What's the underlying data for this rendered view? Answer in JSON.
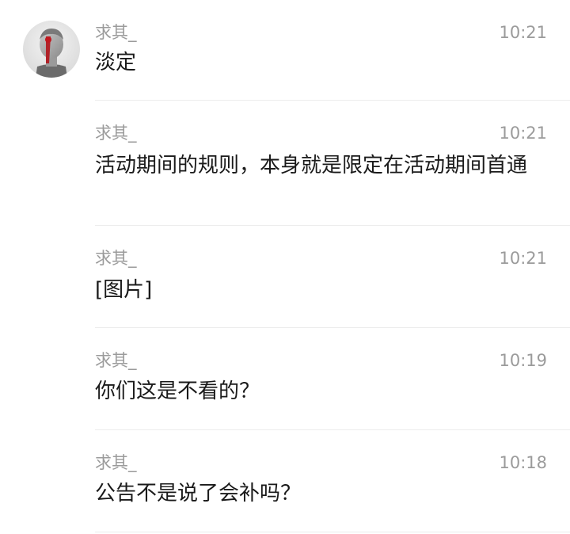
{
  "messages": [
    {
      "sender": "求其_",
      "time": "10:21",
      "text": "淡定",
      "avatar": "avatar-image"
    },
    {
      "sender": "求其_",
      "time": "10:21",
      "text": "活动期间的规则，本身就是限定在活动期间首通"
    },
    {
      "sender": "求其_",
      "time": "10:21",
      "text": "[图片]"
    },
    {
      "sender": "求其_",
      "time": "10:19",
      "text": "你们这是不看的？"
    },
    {
      "sender": "求其_",
      "time": "10:18",
      "text": "公告不是说了会补吗？"
    }
  ]
}
